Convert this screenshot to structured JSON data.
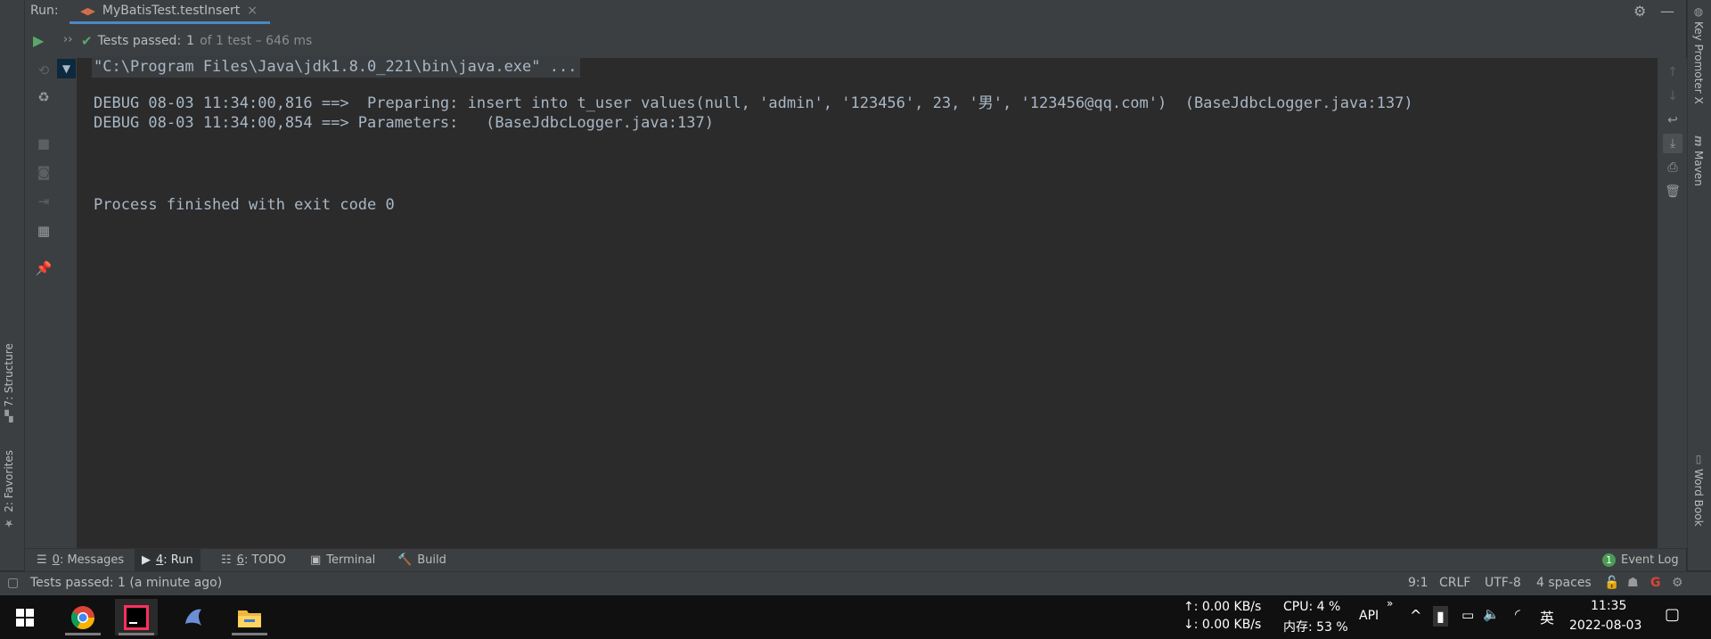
{
  "run_header": {
    "run_label": "Run:",
    "tab_title": "MyBatisTest.testInsert",
    "tab_close": "×"
  },
  "test_status": {
    "prefix": "Tests passed:",
    "count": "1",
    "suffix": "of 1 test – 646 ms"
  },
  "console": {
    "lines": [
      "\"C:\\Program Files\\Java\\jdk1.8.0_221\\bin\\java.exe\" ...",
      "DEBUG 08-03 11:34:00,816 ==>  Preparing: insert into t_user values(null, 'admin', '123456', 23, '男', '123456@qq.com')  (BaseJdbcLogger.java:137)",
      "DEBUG 08-03 11:34:00,854 ==> Parameters:   (BaseJdbcLogger.java:137)",
      "Process finished with exit code 0"
    ]
  },
  "left_side_tabs": {
    "structure": "7: Structure",
    "favorites": "2: Favorites"
  },
  "right_side_tabs": {
    "key_promoter": "Key Promoter X",
    "maven": "Maven",
    "word_book": "Word Book"
  },
  "tool_windows": {
    "messages_num": "0",
    "messages": ": Messages",
    "run_num": "4",
    "run": ": Run",
    "todo_num": "6",
    "todo": ": TODO",
    "terminal": "Terminal",
    "build": "Build",
    "event_log_count": "1",
    "event_log": "Event Log"
  },
  "status_bar": {
    "message": "Tests passed: 1 (a minute ago)",
    "position": "9:1",
    "line_sep": "CRLF",
    "encoding": "UTF-8",
    "indent": "4 spaces"
  },
  "taskbar": {
    "net_up": "↑: 0.00 KB/s",
    "net_down": "↓: 0.00 KB/s",
    "cpu": "CPU: 4 %",
    "mem": "内存: 53 %",
    "api": "API",
    "ime": "英",
    "time": "11:35",
    "date": "2022-08-03"
  },
  "colors": {
    "accent": "#4a88c7",
    "pass_green": "#59a869",
    "console_bg": "#2b2b2b",
    "panel_bg": "#3c3f41"
  }
}
